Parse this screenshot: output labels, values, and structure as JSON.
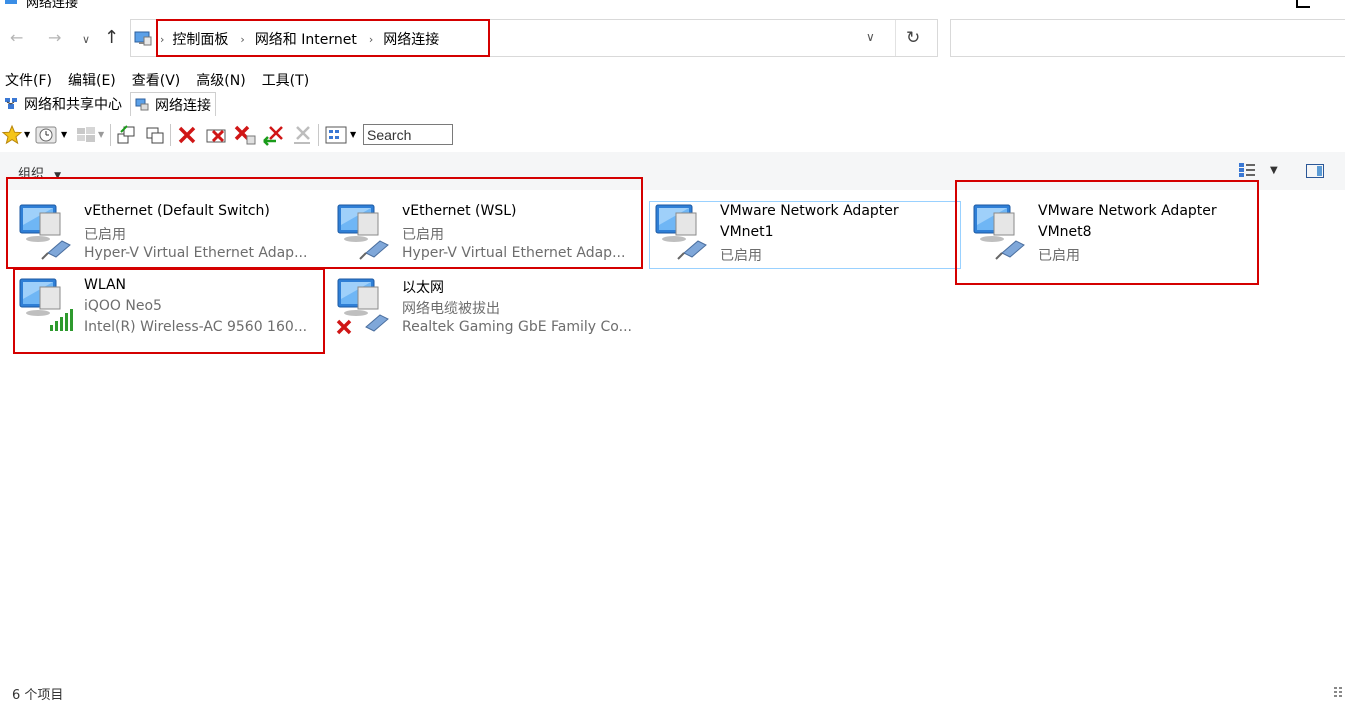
{
  "window": {
    "title": "网络连接"
  },
  "address": {
    "crumbs": [
      "控制面板",
      "网络和 Internet",
      "网络连接"
    ]
  },
  "menu": [
    "文件(F)",
    "编辑(E)",
    "查看(V)",
    "高级(N)",
    "工具(T)"
  ],
  "tabs": [
    {
      "label": "网络和共享中心",
      "active": false
    },
    {
      "label": "网络连接",
      "active": true
    }
  ],
  "toolbar": {
    "search_value": "Search"
  },
  "command_bar": {
    "organize": "组织"
  },
  "items": [
    {
      "name": "vEthernet (Default Switch)",
      "status": "已启用",
      "device": "Hyper-V Virtual Ethernet Adap...",
      "icon": "ethernet-adapter-icon"
    },
    {
      "name": "vEthernet (WSL)",
      "status": "已启用",
      "device": "Hyper-V Virtual Ethernet Adap...",
      "icon": "ethernet-adapter-icon"
    },
    {
      "name": "VMware Network Adapter",
      "name2": "VMnet1",
      "status": "已启用",
      "icon": "ethernet-adapter-icon"
    },
    {
      "name": "VMware Network Adapter",
      "name2": "VMnet8",
      "status": "已启用",
      "icon": "ethernet-adapter-icon"
    },
    {
      "name": "WLAN",
      "status": "iQOO Neo5",
      "device": "Intel(R) Wireless-AC 9560 160...",
      "icon": "wireless-adapter-icon"
    },
    {
      "name": "以太网",
      "status": "网络电缆被拔出",
      "device": "Realtek Gaming GbE Family Co...",
      "icon": "ethernet-disconnected-icon"
    }
  ],
  "status_bar": {
    "count": "6 个项目"
  },
  "colors": {
    "highlight": "#d40000",
    "selection": "#99d1ff",
    "monitor": "#2f7fd6"
  }
}
